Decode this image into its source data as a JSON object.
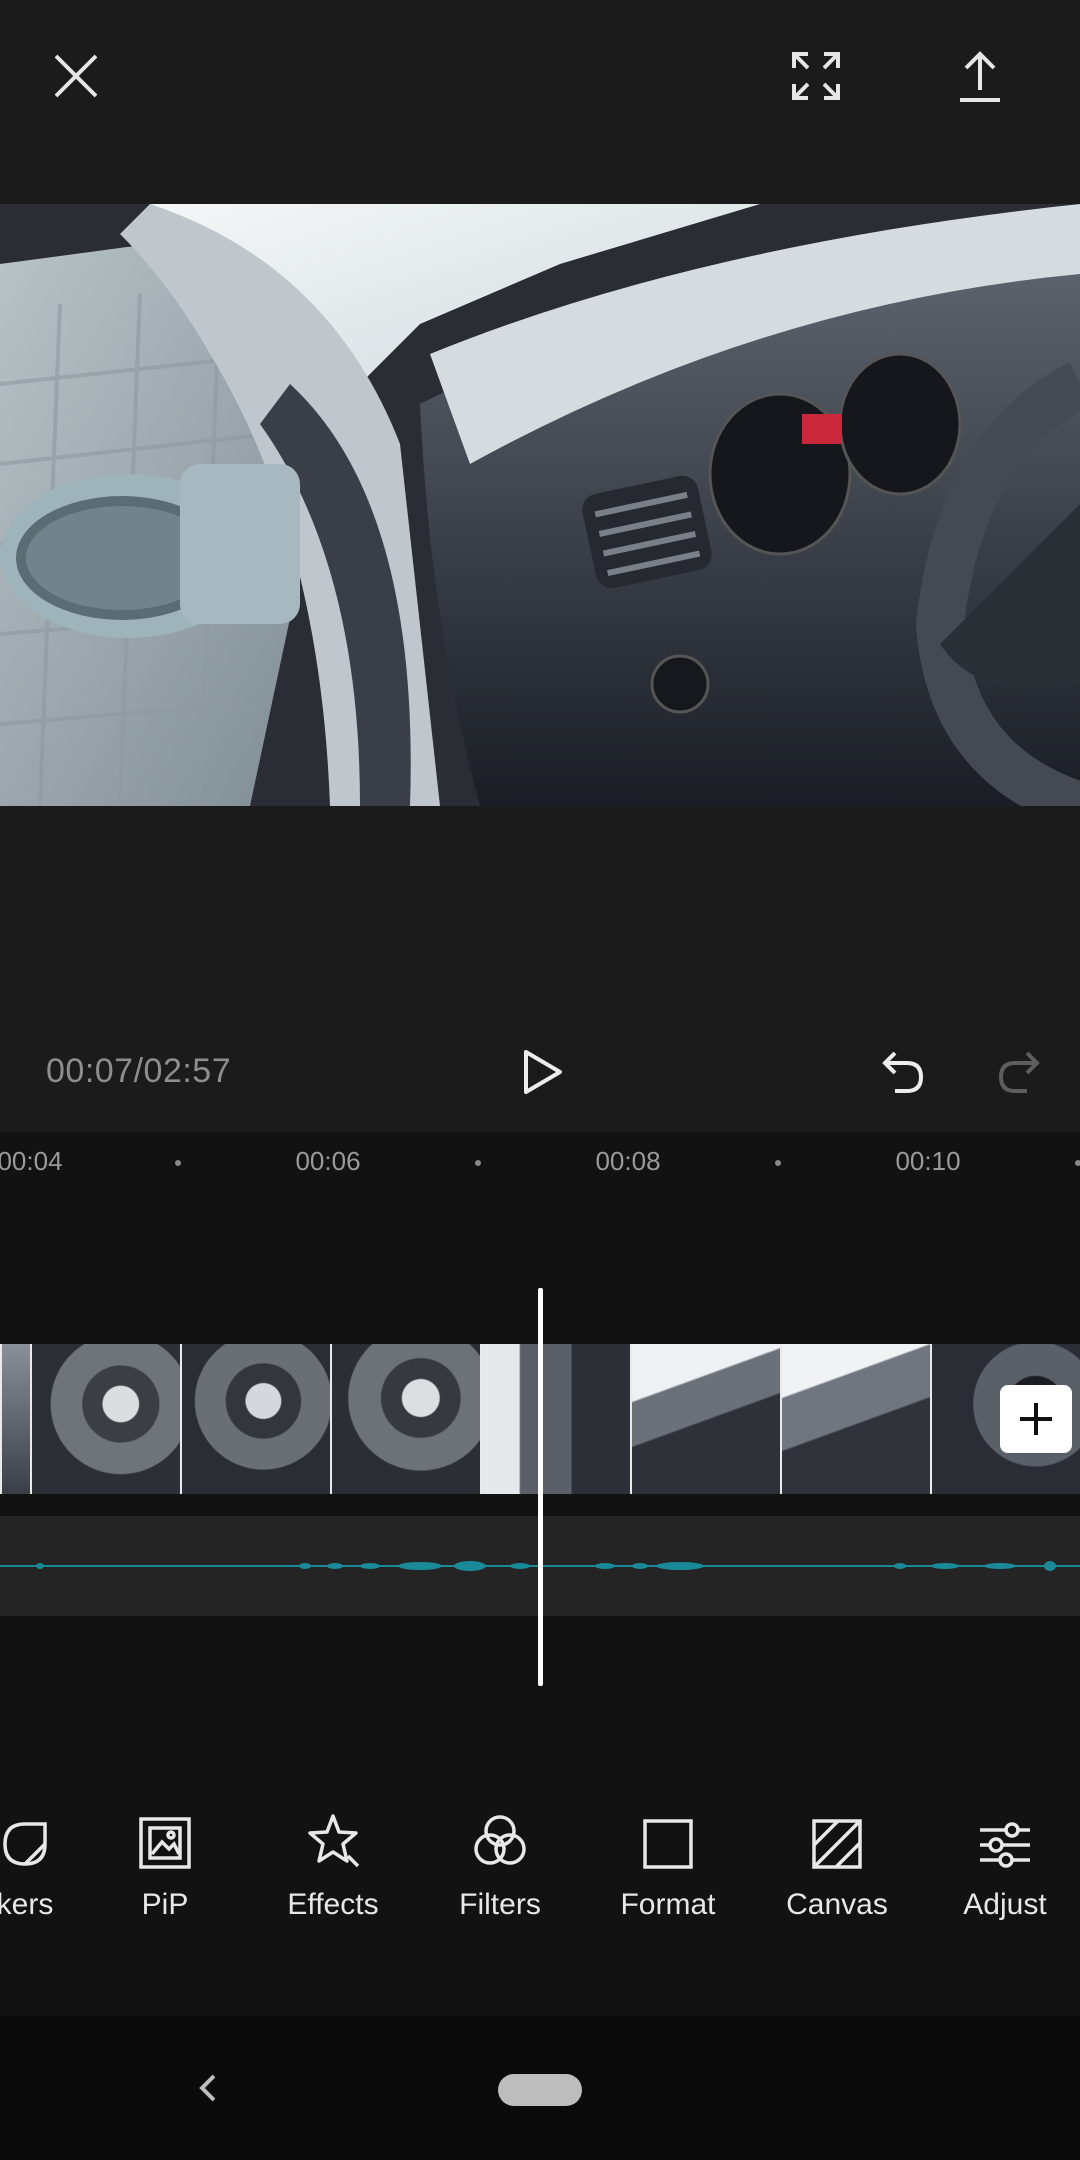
{
  "top_bar": {
    "close_icon": "close-icon",
    "fullscreen_icon": "fullscreen-icon",
    "export_icon": "export-upload-icon"
  },
  "playback": {
    "time": "00:07/02:57",
    "play_icon": "play-icon",
    "undo_icon": "undo-icon",
    "redo_icon": "redo-icon",
    "redo_enabled": false
  },
  "timeline": {
    "ticks": [
      "00:04",
      "00:06",
      "00:08",
      "00:10"
    ],
    "add_clip_icon": "plus-icon"
  },
  "tools": [
    {
      "label": "Stickers",
      "visible_label": "kers",
      "icon": "sticker-icon"
    },
    {
      "label": "PiP",
      "visible_label": "PiP",
      "icon": "pip-icon"
    },
    {
      "label": "Effects",
      "visible_label": "Effects",
      "icon": "effects-star-icon"
    },
    {
      "label": "Filters",
      "visible_label": "Filters",
      "icon": "filters-icon"
    },
    {
      "label": "Format",
      "visible_label": "Format",
      "icon": "format-square-icon"
    },
    {
      "label": "Canvas",
      "visible_label": "Canvas",
      "icon": "canvas-icon"
    },
    {
      "label": "Adjust",
      "visible_label": "Adjust",
      "icon": "adjust-sliders-icon"
    }
  ],
  "colors": {
    "background": "#121212",
    "panel": "#1b1b1b",
    "audio_waveform": "#1a8a98",
    "text_secondary": "#8e8e8e"
  }
}
